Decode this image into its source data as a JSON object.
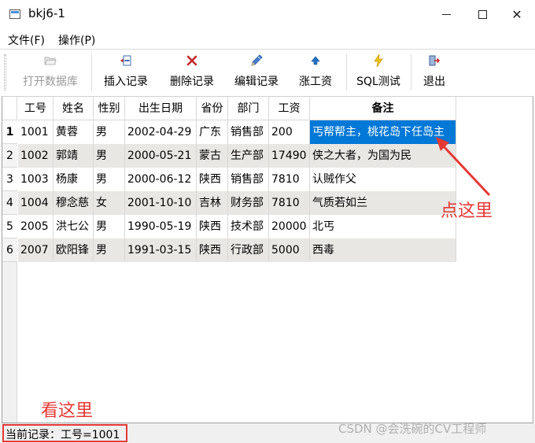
{
  "window": {
    "title": "bkj6-1"
  },
  "menu": [
    {
      "label": "文件(F)"
    },
    {
      "label": "操作(P)"
    }
  ],
  "toolbar": [
    {
      "label": "打开数据库",
      "icon": "folder-open-icon",
      "disabled": true
    },
    {
      "label": "插入记录",
      "icon": "insert-record-icon"
    },
    {
      "label": "删除记录",
      "icon": "delete-x-icon"
    },
    {
      "label": "编辑记录",
      "icon": "pen-edit-icon"
    },
    {
      "label": "涨工资",
      "icon": "up-arrow-icon"
    },
    {
      "label": "SQL测试",
      "icon": "lightning-icon"
    },
    {
      "label": "退出",
      "icon": "exit-door-icon"
    }
  ],
  "table": {
    "columns": [
      "工号",
      "姓名",
      "性别",
      "出生日期",
      "省份",
      "部门",
      "工资",
      "备注"
    ],
    "row_numbers": [
      "1",
      "2",
      "3",
      "4",
      "5",
      "6"
    ],
    "rows": [
      [
        "1001",
        "黄蓉",
        "男",
        "2002-04-29",
        "广东",
        "销售部",
        "200",
        "丐帮帮主，桃花岛下任岛主"
      ],
      [
        "1002",
        "郭靖",
        "男",
        "2000-05-21",
        "蒙古",
        "生产部",
        "17490",
        "侠之大者，为国为民"
      ],
      [
        "1003",
        "杨康",
        "男",
        "2000-06-12",
        "陕西",
        "销售部",
        "7810",
        "认贼作父"
      ],
      [
        "1004",
        "穆念慈",
        "女",
        "2001-10-10",
        "吉林",
        "财务部",
        "7810",
        "气质若如兰"
      ],
      [
        "2005",
        "洪七公",
        "男",
        "1990-05-19",
        "陕西",
        "技术部",
        "20000",
        "北丐"
      ],
      [
        "2007",
        "欧阳锋",
        "男",
        "1991-03-15",
        "陕西",
        "行政部",
        "5000",
        "西毒"
      ]
    ],
    "selected": {
      "row": 0,
      "column": 7
    }
  },
  "status": {
    "text": "当前记录：工号=1001"
  },
  "annotations": {
    "click_here": "点这里",
    "look_here": "看这里",
    "color": "#e53935"
  },
  "watermark": "CSDN @会洗碗的CV工程师",
  "colors": {
    "selection": "#0078d7",
    "alt_row": "#e9e7e3"
  }
}
